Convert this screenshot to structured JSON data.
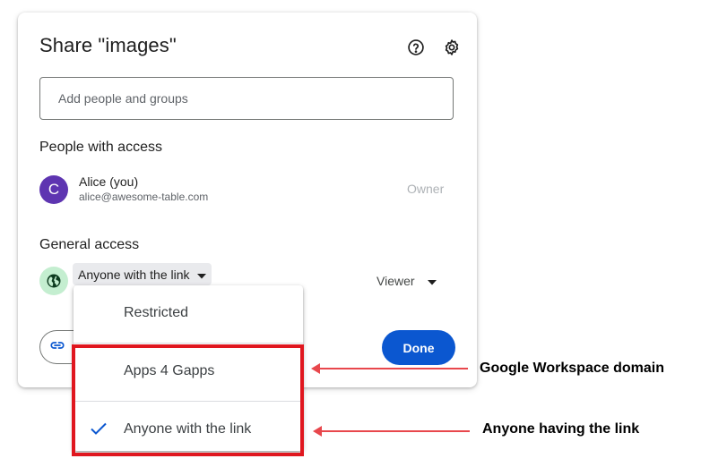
{
  "dialog": {
    "title": "Share \"images\"",
    "help_icon": "help-circle-icon",
    "settings_icon": "gear-icon"
  },
  "add_people": {
    "placeholder": "Add people and groups"
  },
  "people_section": {
    "title": "People with access",
    "users": [
      {
        "initial": "C",
        "name": "Alice (you)",
        "email": "alice@awesome-table.com",
        "role": "Owner",
        "avatar_color": "#5e35b1"
      }
    ]
  },
  "general_access": {
    "title": "General access",
    "globe_icon": "globe-icon",
    "selected": "Anyone with the link",
    "role": "Viewer"
  },
  "dropdown_menu": {
    "items": [
      {
        "label": "Restricted",
        "checked": false
      },
      {
        "label": "Apps 4 Gapps",
        "checked": false
      },
      {
        "label": "Anyone with the link",
        "checked": true
      }
    ]
  },
  "footer": {
    "copy_link_icon": "link-icon",
    "done_label": "Done"
  },
  "annotations": {
    "domain_note": "Google Workspace domain",
    "link_note": "Anyone having the link",
    "highlight_color": "#e0171f",
    "arrow_color": "#e8474c"
  },
  "colors": {
    "primary": "#0b57d0",
    "globe_bg": "#c4eed0",
    "select_bg": "#e9eaed"
  }
}
